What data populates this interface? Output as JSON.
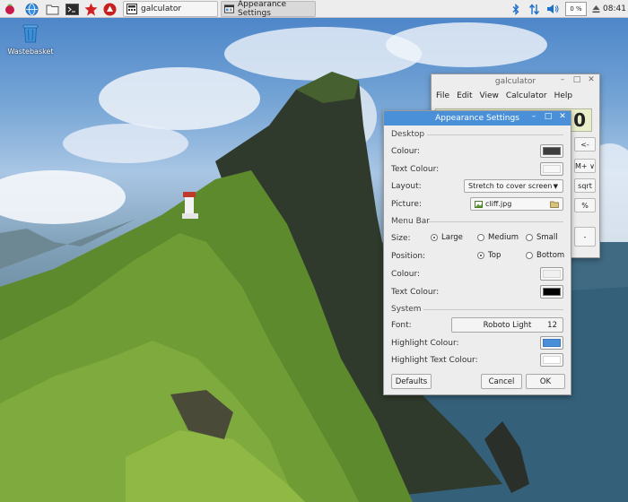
{
  "taskbar": {
    "tasks": [
      {
        "label": "galculator",
        "active": false
      },
      {
        "label": "Appearance Settings",
        "active": true
      }
    ],
    "tray": {
      "cpu": "0 %",
      "time": "08:41"
    }
  },
  "desktop": {
    "wastebasket_label": "Wastebasket"
  },
  "calculator": {
    "title": "galculator",
    "menu": [
      "File",
      "Edit",
      "View",
      "Calculator",
      "Help"
    ],
    "display": "0",
    "buttons": [
      "<-",
      "M+ ∨",
      "sqrt",
      "%",
      "-"
    ]
  },
  "appearance": {
    "title": "Appearance Settings",
    "desktop": {
      "heading": "Desktop",
      "colour_label": "Colour:",
      "colour": "#3d3d3d",
      "text_colour_label": "Text Colour:",
      "text_colour": "#f7f7f7",
      "layout_label": "Layout:",
      "layout_value": "Stretch to cover screen",
      "picture_label": "Picture:",
      "picture_value": "cliff.jpg"
    },
    "menubar": {
      "heading": "Menu Bar",
      "size_label": "Size:",
      "size_options": [
        "Large",
        "Medium",
        "Small"
      ],
      "size_selected": "Large",
      "position_label": "Position:",
      "position_options": [
        "Top",
        "Bottom"
      ],
      "position_selected": "Top",
      "colour_label": "Colour:",
      "colour": "#f0f0f0",
      "text_colour_label": "Text Colour:",
      "text_colour": "#000000"
    },
    "system": {
      "heading": "System",
      "font_label": "Font:",
      "font_name": "Roboto Light",
      "font_size": "12",
      "highlight_label": "Highlight Colour:",
      "highlight": "#4a90d9",
      "highlight_text_label": "Highlight Text Colour:",
      "highlight_text": "#ffffff"
    },
    "buttons": {
      "defaults": "Defaults",
      "cancel": "Cancel",
      "ok": "OK"
    }
  }
}
